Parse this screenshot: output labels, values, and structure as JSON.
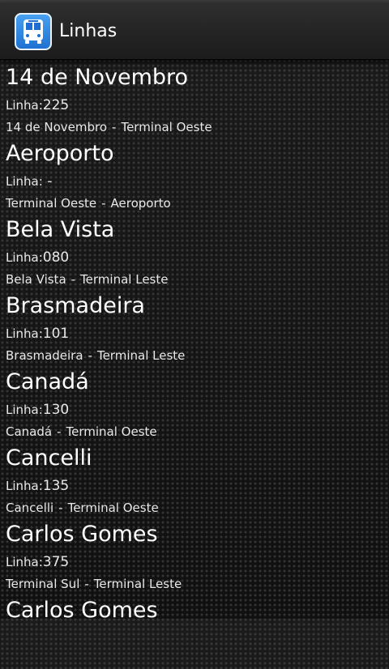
{
  "app": {
    "title": "Linhas",
    "icon": "bus-icon"
  },
  "line_prefix": "Linha:",
  "route_separator": "-",
  "items": [
    {
      "name": "14 de Novembro",
      "line": "225",
      "from": "14 de Novembro",
      "to": "Terminal Oeste"
    },
    {
      "name": "Aeroporto",
      "line": " -",
      "from": "Terminal Oeste",
      "to": "Aeroporto"
    },
    {
      "name": "Bela Vista",
      "line": "080",
      "from": "Bela Vista",
      "to": "Terminal Leste"
    },
    {
      "name": "Brasmadeira",
      "line": "101",
      "from": "Brasmadeira",
      "to": "Terminal Leste"
    },
    {
      "name": "Canadá",
      "line": "130",
      "from": "Canadá",
      "to": "Terminal Oeste"
    },
    {
      "name": "Cancelli",
      "line": "135",
      "from": "Cancelli",
      "to": "Terminal Oeste"
    },
    {
      "name": "Carlos Gomes",
      "line": "375",
      "from": "Terminal Sul",
      "to": "Terminal Leste"
    },
    {
      "name": "Carlos Gomes",
      "line": "",
      "from": "",
      "to": ""
    }
  ]
}
